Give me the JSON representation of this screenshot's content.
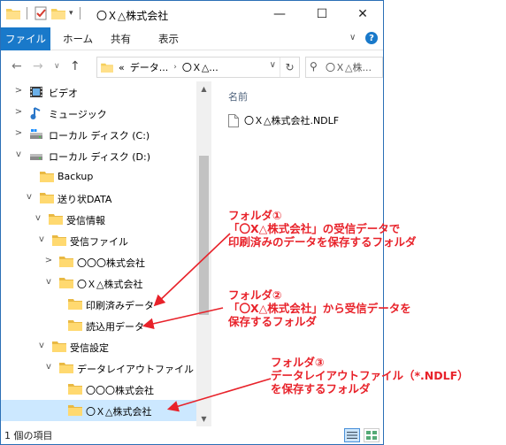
{
  "window": {
    "title": "〇Ｘ△株式会社",
    "controls": {
      "minimize": "—",
      "maximize": "☐",
      "close": "✕"
    }
  },
  "ribbon": {
    "tabs": [
      "ファイル",
      "ホーム",
      "共有",
      "表示"
    ],
    "help": "?"
  },
  "address": {
    "prefix": "«",
    "segments": [
      "データ...",
      "〇Ｘ△..."
    ],
    "search_placeholder": "〇Ｘ△株..."
  },
  "tree": [
    {
      "label": "ビデオ",
      "icon": "video-icon",
      "expander": ">"
    },
    {
      "label": "ミュージック",
      "icon": "music-icon",
      "expander": ">"
    },
    {
      "label": "ローカル ディスク (C:)",
      "icon": "drive-icon",
      "expander": ">"
    },
    {
      "label": "ローカル ディスク (D:)",
      "icon": "drive-icon",
      "expander": "v"
    },
    {
      "label": "Backup",
      "icon": "folder-icon",
      "expander": ""
    },
    {
      "label": "送り状DATA",
      "icon": "folder-icon",
      "expander": "v"
    },
    {
      "label": "受信情報",
      "icon": "folder-icon",
      "expander": "v"
    },
    {
      "label": "受信ファイル",
      "icon": "folder-icon",
      "expander": "v"
    },
    {
      "label": "〇〇〇株式会社",
      "icon": "folder-icon",
      "expander": ">"
    },
    {
      "label": "〇Ｘ△株式会社",
      "icon": "folder-icon",
      "expander": "v"
    },
    {
      "label": "印刷済みデータ",
      "icon": "folder-icon",
      "expander": ""
    },
    {
      "label": "読込用データ",
      "icon": "folder-icon",
      "expander": ""
    },
    {
      "label": "受信設定",
      "icon": "folder-icon",
      "expander": "v"
    },
    {
      "label": "データレイアウトファイル",
      "icon": "folder-icon",
      "expander": "v"
    },
    {
      "label": "〇〇〇株式会社",
      "icon": "folder-icon",
      "expander": ""
    },
    {
      "label": "〇Ｘ△株式会社",
      "icon": "folder-icon",
      "expander": "",
      "selected": true
    }
  ],
  "content": {
    "column_name": "名前",
    "files": [
      "〇Ｘ△株式会社.NDLF"
    ]
  },
  "status": {
    "item_count": "1 個の項目"
  },
  "annotations": {
    "a1": [
      "フォルダ①",
      "「〇X△株式会社」の受信データで",
      "印刷済みのデータを保存するフォルダ"
    ],
    "a2": [
      "フォルダ②",
      "「〇X△株式会社」から受信データを",
      "保存するフォルダ"
    ],
    "a3": [
      "フォルダ③",
      "データレイアウトファイル（*.NDLF）",
      "を保存するフォルダ"
    ],
    "color": "#e8222a"
  }
}
